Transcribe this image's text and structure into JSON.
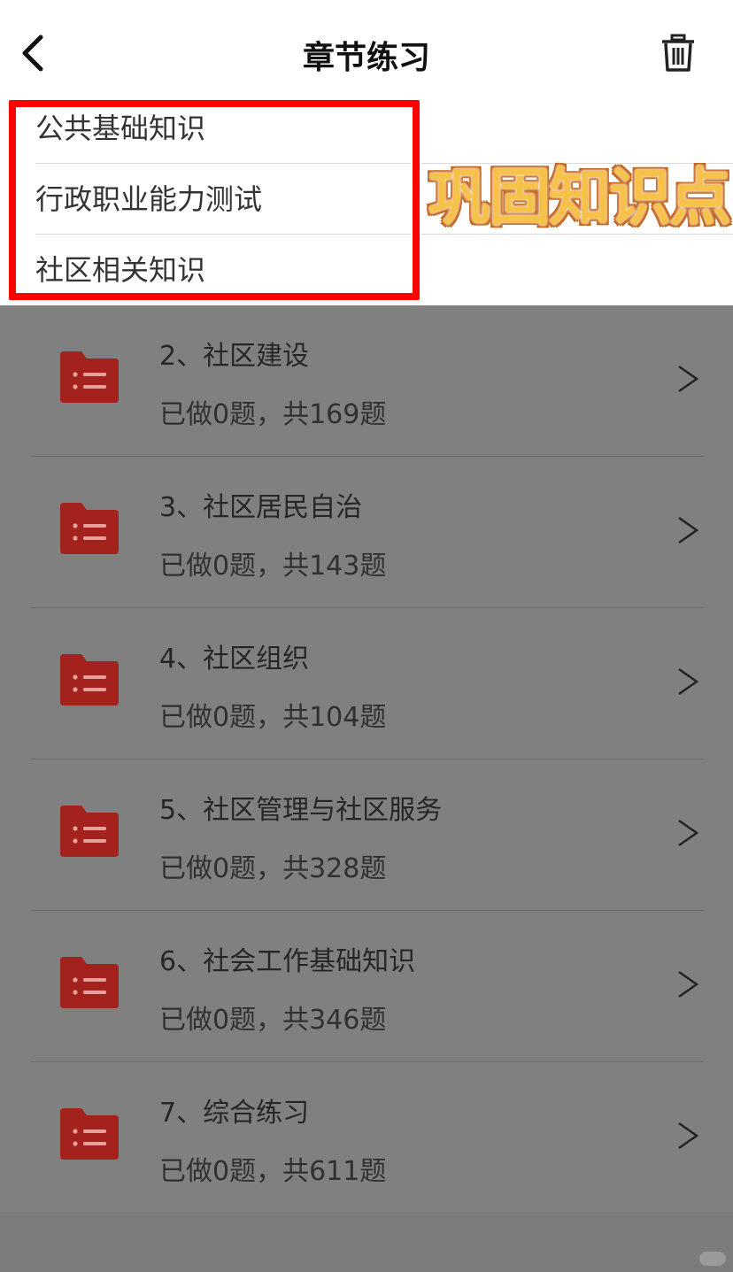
{
  "header": {
    "title": "章节练习"
  },
  "dropdown": {
    "items": [
      {
        "label": "公共基础知识"
      },
      {
        "label": "行政职业能力测试"
      },
      {
        "label": "社区相关知识"
      }
    ]
  },
  "sticker": {
    "text": "巩固知识点"
  },
  "colors": {
    "overlay_gray": "#808080",
    "folder_red": "#a3221e",
    "highlight_red": "#ff0000"
  },
  "chapters": [
    {
      "title": "2、社区建设",
      "progress": "已做0题，共169题"
    },
    {
      "title": "3、社区居民自治",
      "progress": "已做0题，共143题"
    },
    {
      "title": "4、社区组织",
      "progress": "已做0题，共104题"
    },
    {
      "title": "5、社区管理与社区服务",
      "progress": "已做0题，共328题"
    },
    {
      "title": "6、社会工作基础知识",
      "progress": "已做0题，共346题"
    },
    {
      "title": "7、综合练习",
      "progress": "已做0题，共611题"
    }
  ]
}
